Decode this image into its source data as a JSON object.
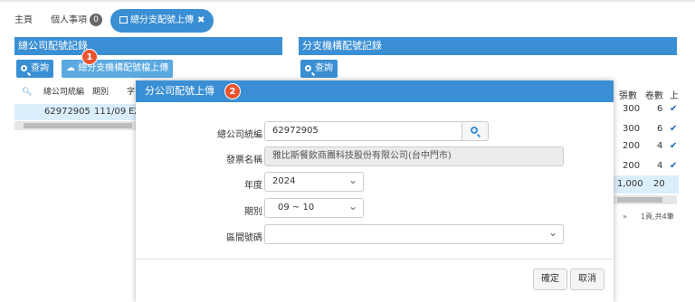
{
  "tabs": {
    "home": "主頁",
    "personal": "個人事項",
    "personal_count": "0",
    "active": "總分支配號上傳"
  },
  "left_panel": {
    "title": "總公司配號記錄",
    "query_button": "查詢",
    "upload_button": "總分支機構配號檔上傳",
    "marker": "1",
    "columns": [
      "總公司統編",
      "期別",
      "字"
    ],
    "row": [
      "62972905",
      "111/09",
      "EZ"
    ]
  },
  "right_panel": {
    "title": "分支機構配號記錄",
    "query_button": "查詢",
    "columns": [
      "張數",
      "卷數",
      "上"
    ],
    "rows": [
      {
        "count": "300",
        "rolls": "6",
        "checked": true
      },
      {
        "count": "300",
        "rolls": "6",
        "checked": true
      },
      {
        "count": "200",
        "rolls": "4",
        "checked": true
      },
      {
        "count": "200",
        "rolls": "4",
        "checked": true
      },
      {
        "count": "1,000",
        "rolls": "20",
        "checked": false
      }
    ],
    "pager_next": "»",
    "pager_info": "1頁,共4筆"
  },
  "modal": {
    "title": "分公司配號上傳",
    "marker": "2",
    "fields": {
      "hq_id_label": "總公司統編",
      "hq_id_value": "62972905",
      "invoice_name_label": "發票名稱",
      "invoice_name_value": "雅比斯餐飲商團科技股份有限公司(台中門市)",
      "year_label": "年度",
      "year_value": "2024",
      "period_label": "期別",
      "period_value": "09 ~ 10",
      "range_label": "區間號碼",
      "range_value": ""
    },
    "confirm": "確定",
    "cancel": "取消"
  },
  "colors": {
    "accent": "#3a8fd4",
    "marker": "#e9542e",
    "selected_row": "#dbeefb"
  }
}
